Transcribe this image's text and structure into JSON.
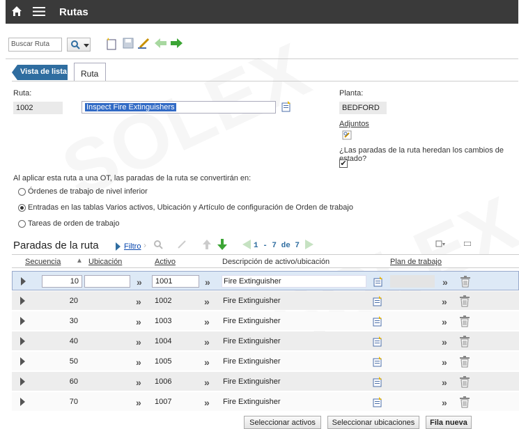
{
  "header": {
    "title": "Rutas"
  },
  "toolbar": {
    "search_placeholder": "Buscar Ruta"
  },
  "tabs": {
    "back": "Vista de lista",
    "current": "Ruta"
  },
  "form": {
    "ruta_label": "Ruta:",
    "ruta_value": "1002",
    "desc_value": "Inspect Fire Extinguishers",
    "planta_label": "Planta:",
    "planta_value": "BEDFORD",
    "adjuntos_label": "Adjuntos",
    "heredan_label": "¿Las paradas de la ruta heredan los cambios de estado?",
    "heredan_checked": "✔",
    "aplicar_text": "Al aplicar esta ruta a una OT, las paradas de la ruta se convertirán en:",
    "options": [
      "Órdenes de trabajo de nivel inferior",
      "Entradas en las tablas Varios activos, Ubicación y Artículo de configuración de Orden de trabajo",
      "Tareas de orden de trabajo"
    ],
    "selected_option": 1
  },
  "grid": {
    "title": "Paradas de la ruta",
    "filter_label": "Filtro",
    "pager": "1 - 7 de 7",
    "headers": {
      "secuencia": "Secuencia",
      "ubicacion": "Ubicación",
      "activo": "Activo",
      "descripcion": "Descripción de activo/ubicación",
      "plan": "Plan de trabajo"
    },
    "rows": [
      {
        "seq": "10",
        "activo": "1001",
        "desc": "Fire Extinguisher"
      },
      {
        "seq": "20",
        "activo": "1002",
        "desc": "Fire Extinguisher"
      },
      {
        "seq": "30",
        "activo": "1003",
        "desc": "Fire Extinguisher"
      },
      {
        "seq": "40",
        "activo": "1004",
        "desc": "Fire Extinguisher"
      },
      {
        "seq": "50",
        "activo": "1005",
        "desc": "Fire Extinguisher"
      },
      {
        "seq": "60",
        "activo": "1006",
        "desc": "Fire Extinguisher"
      },
      {
        "seq": "70",
        "activo": "1007",
        "desc": "Fire Extinguisher"
      }
    ]
  },
  "buttons": {
    "select_assets": "Seleccionar activos",
    "select_locations": "Seleccionar ubicaciones",
    "new_row": "Fila nueva"
  },
  "colors": {
    "topbar": "#3a3a3a",
    "accent": "#2f6da0",
    "selection": "#316ac5"
  }
}
